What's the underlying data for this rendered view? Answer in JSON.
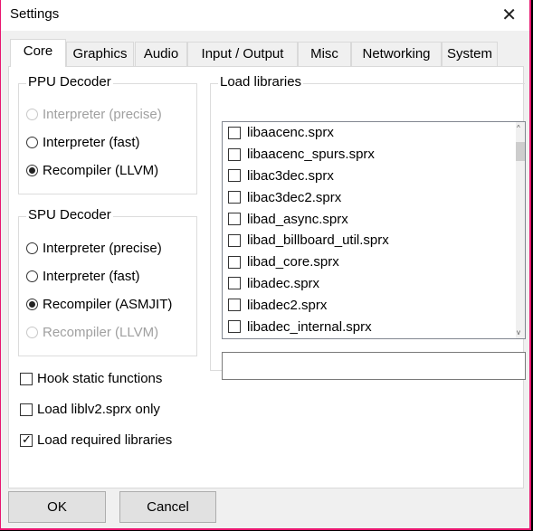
{
  "window": {
    "title": "Settings",
    "close_icon": "close-icon"
  },
  "tabs": [
    "Core",
    "Graphics",
    "Audio",
    "Input / Output",
    "Misc",
    "Networking",
    "System"
  ],
  "active_tab": "Core",
  "ppu": {
    "label": "PPU Decoder",
    "options": [
      {
        "label": "Interpreter (precise)",
        "selected": false,
        "disabled": true
      },
      {
        "label": "Interpreter (fast)",
        "selected": false,
        "disabled": false
      },
      {
        "label": "Recompiler (LLVM)",
        "selected": true,
        "disabled": false
      }
    ]
  },
  "spu": {
    "label": "SPU Decoder",
    "options": [
      {
        "label": "Interpreter (precise)",
        "selected": false,
        "disabled": false
      },
      {
        "label": "Interpreter (fast)",
        "selected": false,
        "disabled": false
      },
      {
        "label": "Recompiler (ASMJIT)",
        "selected": true,
        "disabled": false
      },
      {
        "label": "Recompiler (LLVM)",
        "selected": false,
        "disabled": true
      }
    ]
  },
  "checks": [
    {
      "label": "Hook static functions",
      "checked": false
    },
    {
      "label": "Load liblv2.sprx only",
      "checked": false
    },
    {
      "label": "Load required libraries",
      "checked": true
    }
  ],
  "libraries": {
    "label": "Load libraries",
    "items": [
      "libaacenc.sprx",
      "libaacenc_spurs.sprx",
      "libac3dec.sprx",
      "libac3dec2.sprx",
      "libad_async.sprx",
      "libad_billboard_util.sprx",
      "libad_core.sprx",
      "libadec.sprx",
      "libadec2.sprx",
      "libadec_internal.sprx"
    ],
    "search_value": ""
  },
  "buttons": {
    "ok": "OK",
    "cancel": "Cancel"
  }
}
